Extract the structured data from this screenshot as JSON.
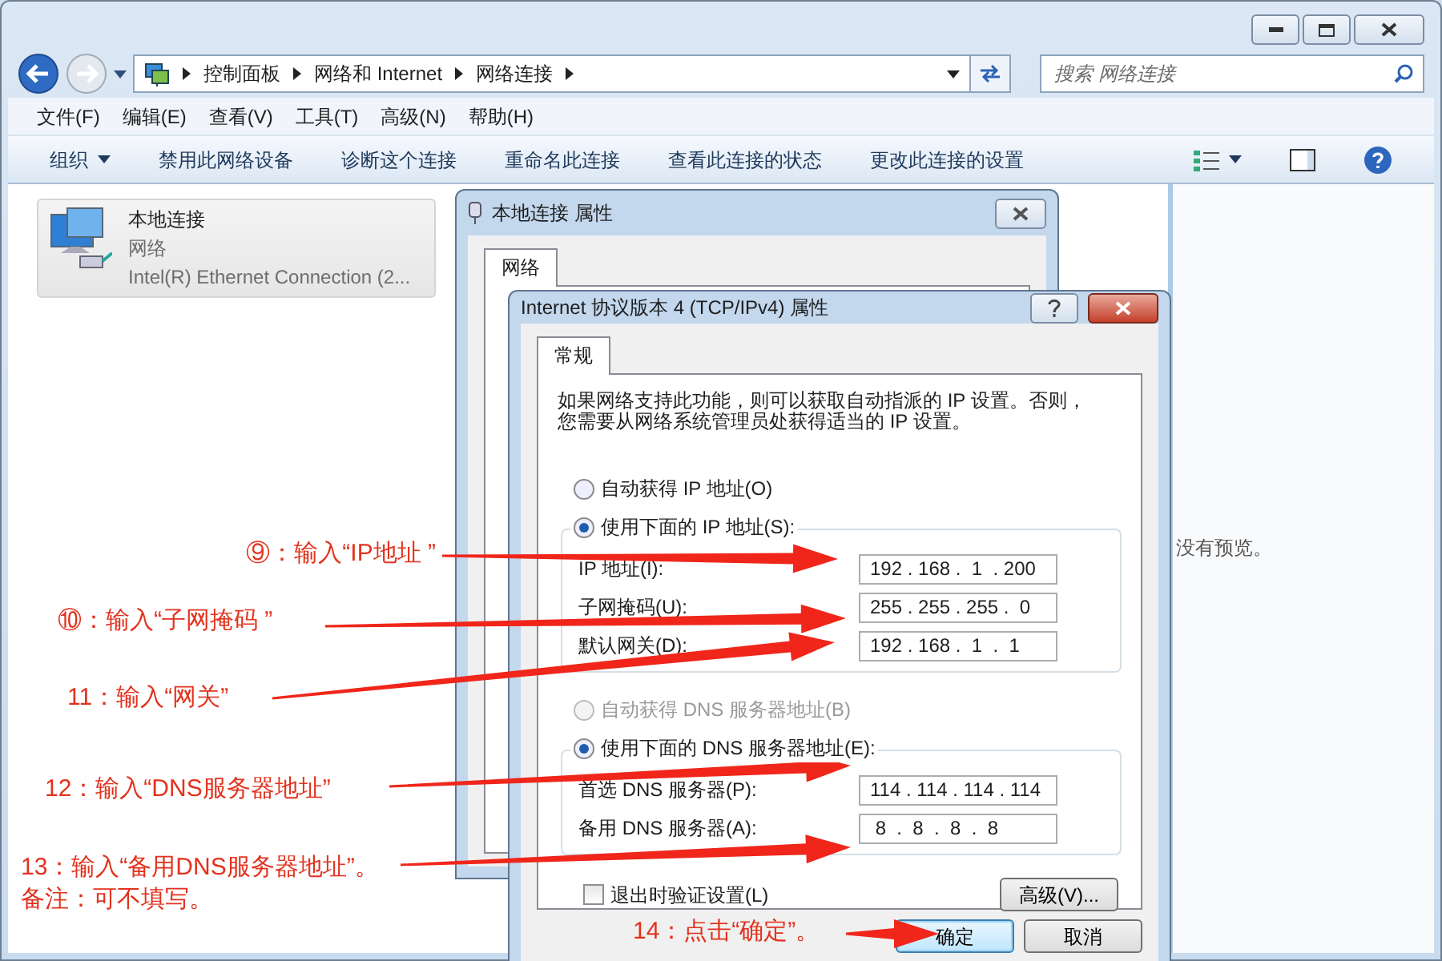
{
  "explorer": {
    "breadcrumb": [
      "控制面板",
      "网络和 Internet",
      "网络连接"
    ],
    "search": {
      "placeholder": "搜索 网络连接"
    },
    "menu": [
      "文件(F)",
      "编辑(E)",
      "查看(V)",
      "工具(T)",
      "高级(N)",
      "帮助(H)"
    ],
    "toolbar": [
      {
        "label": "组织",
        "dropdown": true
      },
      {
        "label": "禁用此网络设备",
        "dropdown": false
      },
      {
        "label": "诊断这个连接",
        "dropdown": false
      },
      {
        "label": "重命名此连接",
        "dropdown": false
      },
      {
        "label": "查看此连接的状态",
        "dropdown": false
      },
      {
        "label": "更改此连接的设置",
        "dropdown": false
      }
    ],
    "connections": [
      {
        "name": "本地连接",
        "type": "网络",
        "adapter": "Intel(R) Ethernet Connection (2...",
        "selected": true
      }
    ],
    "preview": "没有预览。"
  },
  "properties_dialog": {
    "title": "本地连接 属性",
    "tabs": [
      {
        "label": "网络",
        "selected": true
      }
    ]
  },
  "ipv4_dialog": {
    "title": "Internet 协议版本 4 (TCP/IPv4) 属性",
    "tabs": [
      {
        "label": "常规",
        "selected": true
      }
    ],
    "description": [
      "如果网络支持此功能，则可以获取自动指派的 IP 设置。否则，",
      "您需要从网络系统管理员处获得适当的 IP 设置。"
    ],
    "ip_options": [
      {
        "label": "自动获得 IP 地址(O)",
        "selected": false,
        "disabled": false
      },
      {
        "label": "使用下面的 IP 地址(S):",
        "selected": true,
        "disabled": false
      }
    ],
    "ip_fields": [
      {
        "label": "IP 地址(I):",
        "value": "192 . 168 .  1  . 200"
      },
      {
        "label": "子网掩码(U):",
        "value": "255 . 255 . 255 .  0"
      },
      {
        "label": "默认网关(D):",
        "value": "192 . 168 .  1  .  1"
      }
    ],
    "dns_options": [
      {
        "label": "自动获得 DNS 服务器地址(B)",
        "selected": false,
        "disabled": true
      },
      {
        "label": "使用下面的 DNS 服务器地址(E):",
        "selected": true,
        "disabled": false
      }
    ],
    "dns_fields": [
      {
        "label": "首选 DNS 服务器(P):",
        "value": "114 . 114 . 114 . 114"
      },
      {
        "label": "备用 DNS 服务器(A):",
        "value": " 8  .  8  .  8  .  8"
      }
    ],
    "validate": {
      "label": "退出时验证设置(L)",
      "checked": false
    },
    "advanced_button": "高级(V)...",
    "buttons": [
      {
        "label": "确定",
        "default": true
      },
      {
        "label": "取消",
        "default": false
      }
    ]
  },
  "annotations": [
    {
      "lines": [
        "⑨：输入“IP地址 ”"
      ]
    },
    {
      "lines": [
        "⑩：输入“子网掩码 ”"
      ]
    },
    {
      "lines": [
        "11：输入“网关”"
      ]
    },
    {
      "lines": [
        "12：输入“DNS服务器地址”"
      ]
    },
    {
      "lines": [
        "13：输入“备用DNS服务器地址”。",
        "备注：可不填写。"
      ]
    },
    {
      "lines": [
        "14：点击“确定”。"
      ]
    }
  ]
}
